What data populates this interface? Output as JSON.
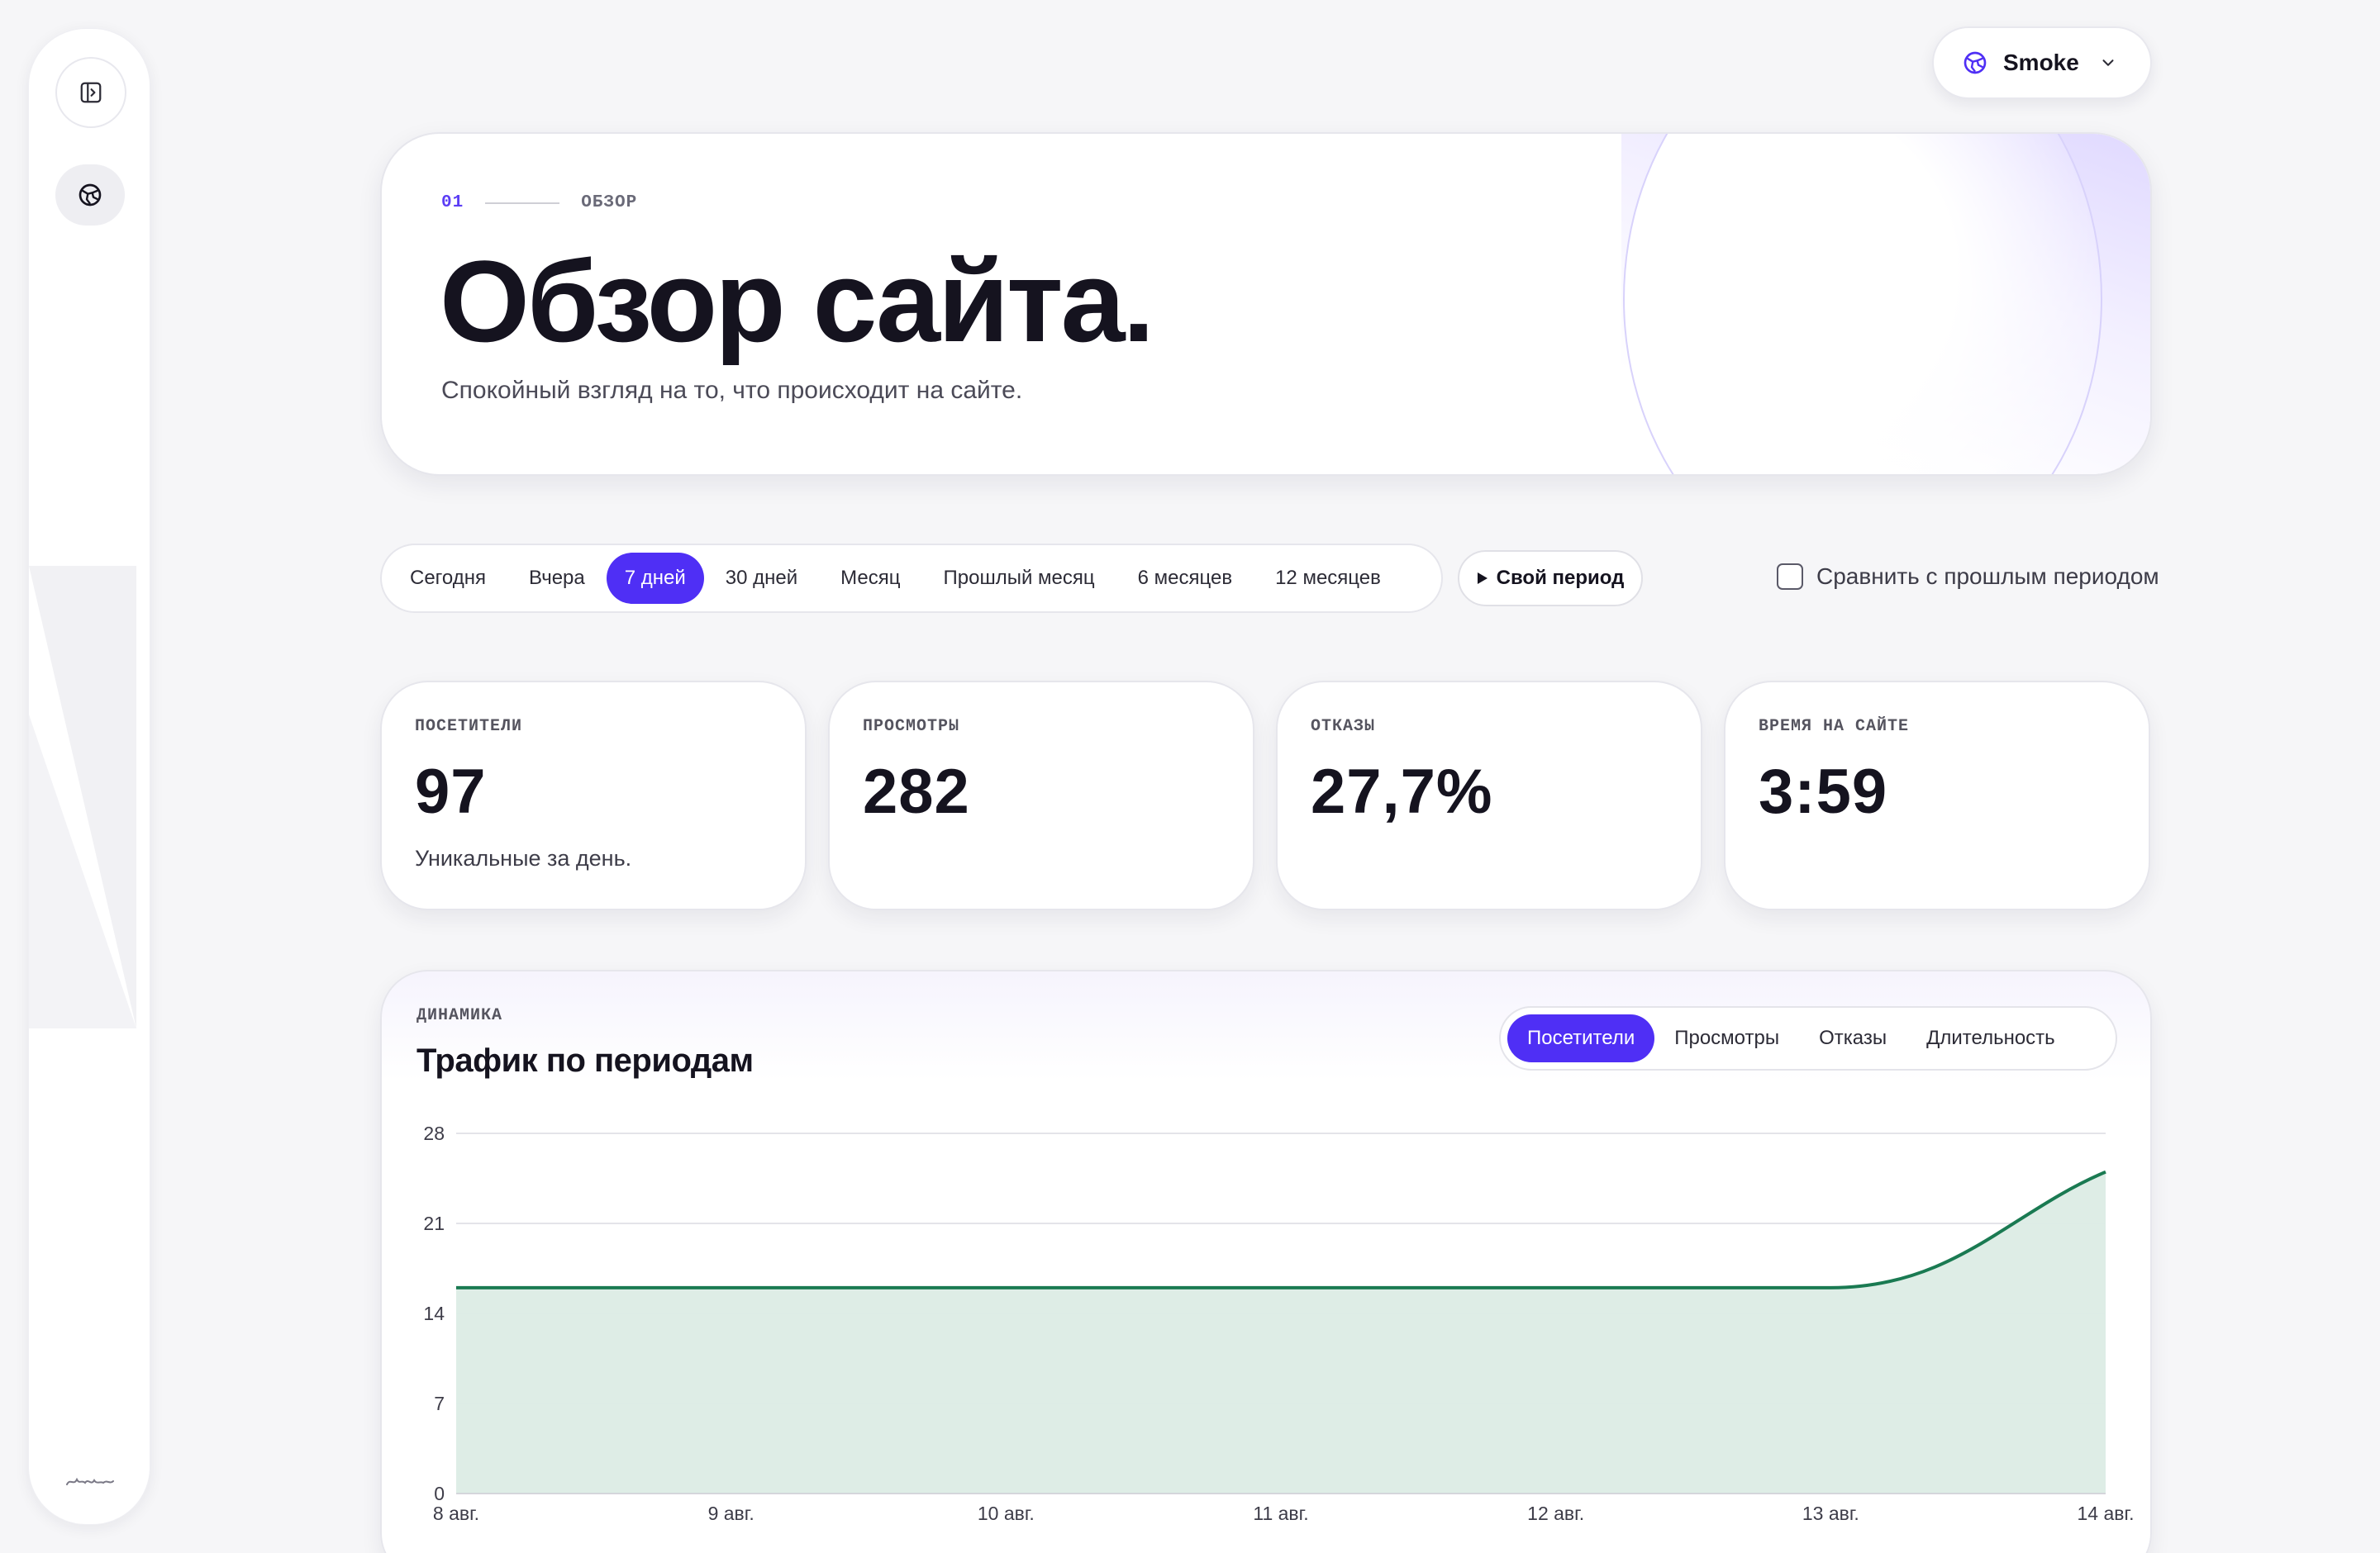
{
  "site_selector": {
    "name": "Smoke",
    "icon": "globe-icon"
  },
  "hero": {
    "eyebrow_num": "01",
    "eyebrow_label": "ОБЗОР",
    "title": "Обзор сайта.",
    "subtitle": "Спокойный взгляд на то, что происходит на сайте."
  },
  "periods": {
    "items": [
      "Сегодня",
      "Вчера",
      "7 дней",
      "30 дней",
      "Месяц",
      "Прошлый месяц",
      "6 месяцев",
      "12 месяцев"
    ],
    "active": "7 дней",
    "custom_label": "Свой период"
  },
  "compare": {
    "label": "Сравнить с прошлым периодом",
    "checked": false
  },
  "stats": [
    {
      "key": "ПОСЕТИТЕЛИ",
      "value": "97",
      "note": "Уникальные за день."
    },
    {
      "key": "ПРОСМОТРЫ",
      "value": "282",
      "note": ""
    },
    {
      "key": "ОТКАЗЫ",
      "value": "27,7%",
      "note": ""
    },
    {
      "key": "ВРЕМЯ НА САЙТЕ",
      "value": "3:59",
      "note": ""
    }
  ],
  "traffic": {
    "eyebrow": "ДИНАМИКА",
    "title": "Трафик по периодам",
    "tabs": [
      "Посетители",
      "Просмотры",
      "Отказы",
      "Длительность"
    ],
    "active_tab": "Посетители"
  },
  "colors": {
    "accent": "#4f2ff5",
    "line": "#1a7a52",
    "area": "#dcece5"
  },
  "chart_data": {
    "type": "area",
    "x": [
      "8 авг.",
      "9 авг.",
      "10 авг.",
      "11 авг.",
      "12 авг.",
      "13 авг.",
      "14 авг."
    ],
    "series": [
      {
        "values": [
          16,
          16,
          16,
          16,
          16,
          16,
          25
        ]
      }
    ],
    "y_ticks": [
      0,
      7,
      14,
      21,
      28
    ],
    "ylim": [
      0,
      28
    ],
    "grid": true
  }
}
